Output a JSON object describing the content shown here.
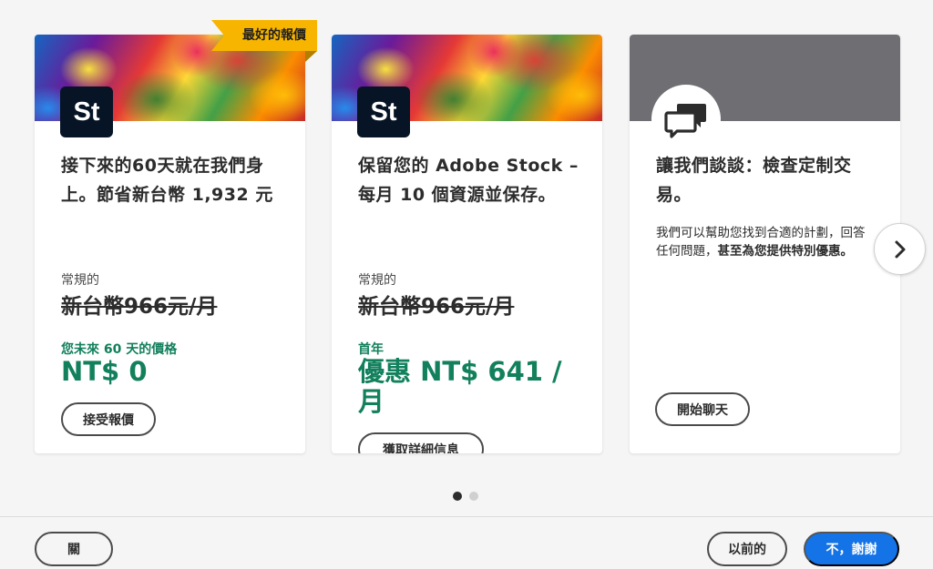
{
  "cards": [
    {
      "badge": "最好的報價",
      "app_icon_text": "St",
      "title": "接下來的60天就在我們身上。節省新台幣 1,932 元",
      "regular_label": "常規的",
      "old_price": "新台幣966元/月",
      "promo_label": "您未來 60 天的價格",
      "promo_price": "NT$ 0",
      "button_label": "接受報價"
    },
    {
      "app_icon_text": "St",
      "title": "保留您的 Adobe Stock – 每月 10 個資源並保存。",
      "regular_label": "常規的",
      "old_price": "新台幣966元/月",
      "promo_label": "首年",
      "promo_price": "優惠 NT$ 641 / 月",
      "button_label": "獲取詳細信息"
    },
    {
      "icon": "chat-bubbles-icon",
      "title": "讓我們談談：檢查定制交易。",
      "description_plain": "我們可以幫助您找到合適的計劃，回答任何問題，",
      "description_bold": "甚至為您提供特別優惠。",
      "button_label": "開始聊天"
    }
  ],
  "carousel": {
    "next_icon": "chevron-right-icon",
    "page_count": 2,
    "active_page": 1
  },
  "footer": {
    "close_label": "關",
    "previous_label": "以前的",
    "decline_label": "不，謝謝"
  },
  "colors": {
    "accent_blue": "#1473e6",
    "promo_green": "#12805c",
    "badge_yellow": "#f7b500",
    "stock_icon_bg": "#061425"
  }
}
